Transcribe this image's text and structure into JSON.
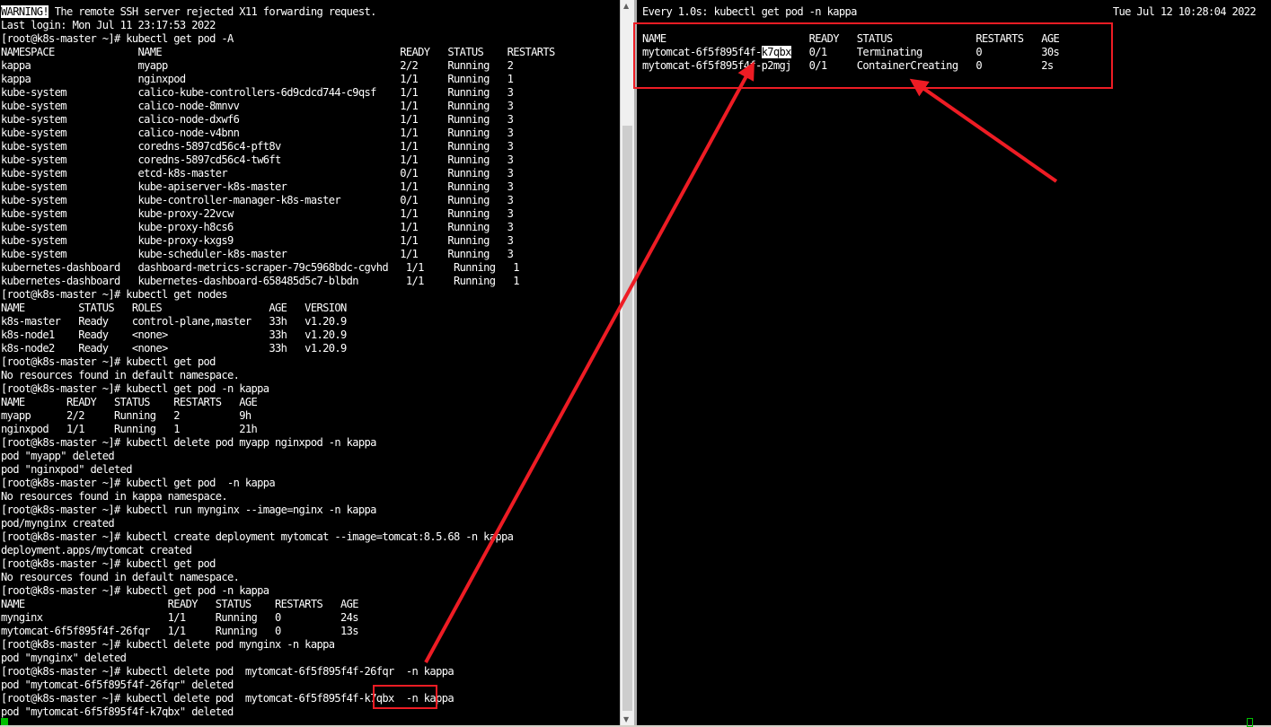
{
  "left_terminal": {
    "lines": [
      {
        "pre": "",
        "hl": "WARNING!",
        "post": " The remote SSH server rejected X11 forwarding request."
      },
      "Last login: Mon Jul 11 23:17:53 2022",
      "[root@k8s-master ~]# kubectl get pod -A",
      "NAMESPACE              NAME                                        READY   STATUS    RESTARTS",
      "kappa                  myapp                                       2/2     Running   2",
      "kappa                  nginxpod                                    1/1     Running   1",
      "kube-system            calico-kube-controllers-6d9cdcd744-c9qsf    1/1     Running   3",
      "kube-system            calico-node-8mnvv                           1/1     Running   3",
      "kube-system            calico-node-dxwf6                           1/1     Running   3",
      "kube-system            calico-node-v4bnn                           1/1     Running   3",
      "kube-system            coredns-5897cd56c4-pft8v                    1/1     Running   3",
      "kube-system            coredns-5897cd56c4-tw6ft                    1/1     Running   3",
      "kube-system            etcd-k8s-master                             0/1     Running   3",
      "kube-system            kube-apiserver-k8s-master                   1/1     Running   3",
      "kube-system            kube-controller-manager-k8s-master          0/1     Running   3",
      "kube-system            kube-proxy-22vcw                            1/1     Running   3",
      "kube-system            kube-proxy-h8cs6                            1/1     Running   3",
      "kube-system            kube-proxy-kxgs9                            1/1     Running   3",
      "kube-system            kube-scheduler-k8s-master                   1/1     Running   3",
      "kubernetes-dashboard   dashboard-metrics-scraper-79c5968bdc-cgvhd   1/1     Running   1",
      "kubernetes-dashboard   kubernetes-dashboard-658485d5c7-blbdn        1/1     Running   1",
      "[root@k8s-master ~]# kubectl get nodes",
      "NAME         STATUS   ROLES                  AGE   VERSION",
      "k8s-master   Ready    control-plane,master   33h   v1.20.9",
      "k8s-node1    Ready    <none>                 33h   v1.20.9",
      "k8s-node2    Ready    <none>                 33h   v1.20.9",
      "[root@k8s-master ~]# kubectl get pod",
      "No resources found in default namespace.",
      "[root@k8s-master ~]# kubectl get pod -n kappa",
      "NAME       READY   STATUS    RESTARTS   AGE",
      "myapp      2/2     Running   2          9h",
      "nginxpod   1/1     Running   1          21h",
      "[root@k8s-master ~]# kubectl delete pod myapp nginxpod -n kappa",
      "pod \"myapp\" deleted",
      "pod \"nginxpod\" deleted",
      "[root@k8s-master ~]# kubectl get pod  -n kappa",
      "No resources found in kappa namespace.",
      "[root@k8s-master ~]# kubectl run mynginx --image=nginx -n kappa",
      "pod/mynginx created",
      "[root@k8s-master ~]# kubectl create deployment mytomcat --image=tomcat:8.5.68 -n kappa",
      "deployment.apps/mytomcat created",
      "[root@k8s-master ~]# kubectl get pod",
      "No resources found in default namespace.",
      "[root@k8s-master ~]# kubectl get pod -n kappa",
      "NAME                        READY   STATUS    RESTARTS   AGE",
      "mynginx                     1/1     Running   0          24s",
      "mytomcat-6f5f895f4f-26fqr   1/1     Running   0          13s",
      "[root@k8s-master ~]# kubectl delete pod mynginx -n kappa",
      "pod \"mynginx\" deleted",
      "[root@k8s-master ~]# kubectl delete pod  mytomcat-6f5f895f4f-26fqr  -n kappa",
      "pod \"mytomcat-6f5f895f4f-26fqr\" deleted",
      "[root@k8s-master ~]# kubectl delete pod  mytomcat-6f5f895f4f-k7qbx  -n kappa",
      "pod \"mytomcat-6f5f895f4f-k7qbx\" deleted"
    ]
  },
  "right_terminal": {
    "lines": [
      "Every 1.0s: kubectl get pod -n kappa                                           Tue Jul 12 10:28:04 2022",
      "",
      "NAME                        READY   STATUS              RESTARTS   AGE",
      {
        "pre": "mytomcat-6f5f895f4f-",
        "hl": "k7qbx",
        "post": "   0/1     Terminating         0          30s"
      },
      "mytomcat-6f5f895f4f-p2mgj   0/1     ContainerCreating   0          2s"
    ]
  },
  "colors": {
    "terminal_bg": "#000000",
    "terminal_fg": "#ffffff",
    "annotation_red": "#ee1c24",
    "cursor_green": "#00c000"
  },
  "icons": {
    "scroll_up": "scroll-up-arrow-icon",
    "scroll_down": "scroll-down-arrow-icon"
  }
}
